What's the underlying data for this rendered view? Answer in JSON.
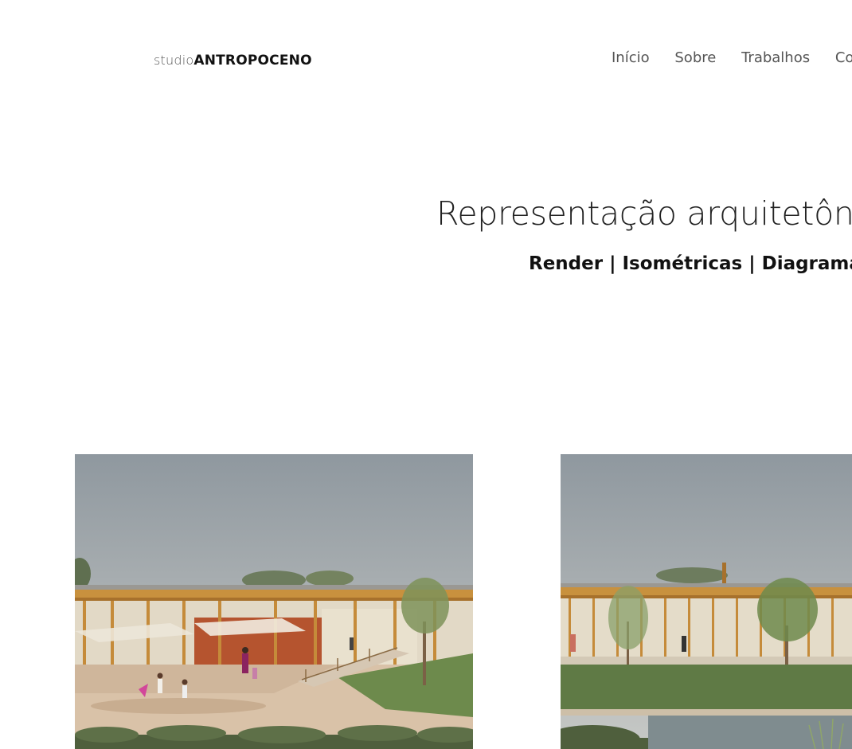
{
  "header": {
    "logo_light": "studio",
    "logo_bold": "ANTROPOCENO",
    "nav": [
      "Início",
      "Sobre",
      "Trabalhos",
      "Contato"
    ]
  },
  "hero": {
    "title": "Representação arquitetônica",
    "subtitle": "Render | Isométricas | Diagramas |"
  },
  "gallery": [
    {
      "image": "architectural-render-school-playground"
    },
    {
      "image": "architectural-render-school-pond"
    }
  ],
  "colors": {
    "sky": "#9aa2a8",
    "wood": "#c8913e",
    "grass": "#5f7a45",
    "plaza": "#d9c2a8",
    "water": "#7f8c8f"
  }
}
